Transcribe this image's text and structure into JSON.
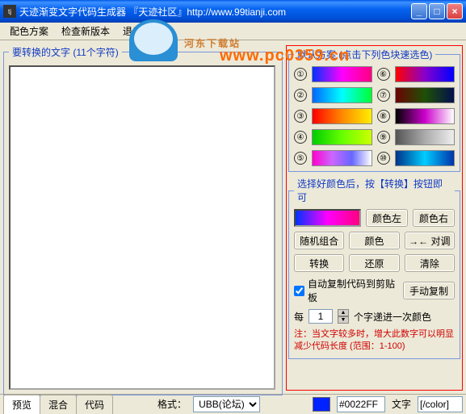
{
  "window": {
    "title": "天迹渐变文字代码生成器    『天迹社区』http://www.99tianji.com",
    "min": "_",
    "max": "□",
    "close": "×"
  },
  "menu": {
    "scheme": "配色方案",
    "update": "检查新版本",
    "exit": "退出"
  },
  "watermark1": "河东下载站",
  "watermark2": "www.pc0359.cn",
  "left": {
    "legend": "要转换的文字 (11个字符)"
  },
  "schemes": {
    "legend": "默认方案 (点击下列色块速选色)",
    "nums": [
      "①",
      "②",
      "③",
      "④",
      "⑤",
      "⑥",
      "⑦",
      "⑧",
      "⑨",
      "⑩"
    ]
  },
  "convert": {
    "legend": "选择好颜色后，按【转换】按钮即可",
    "btn_color_left": "颜色左",
    "btn_color_right": "颜色右",
    "btn_random": "随机组合",
    "btn_color": "颜色",
    "btn_swap": "→← 对调",
    "btn_convert": "转换",
    "btn_restore": "还原",
    "btn_clear": "清除",
    "chk_autoclip": "自动复制代码到剪贴板",
    "btn_manual": "手动复制",
    "step_prefix": "每",
    "step_value": "1",
    "step_suffix": "个字递进一次颜色",
    "note": "注：当文字较多时，增大此数字可以明显减少代码长度 (范围：1-100)"
  },
  "bottom": {
    "tab_preview": "预览",
    "tab_mix": "混合",
    "tab_code": "代码",
    "format_label": "格式：",
    "format_value": "UBB(论坛)",
    "color_hex": "#0022FF",
    "text_label": "文字",
    "text_value": "[/color]"
  }
}
